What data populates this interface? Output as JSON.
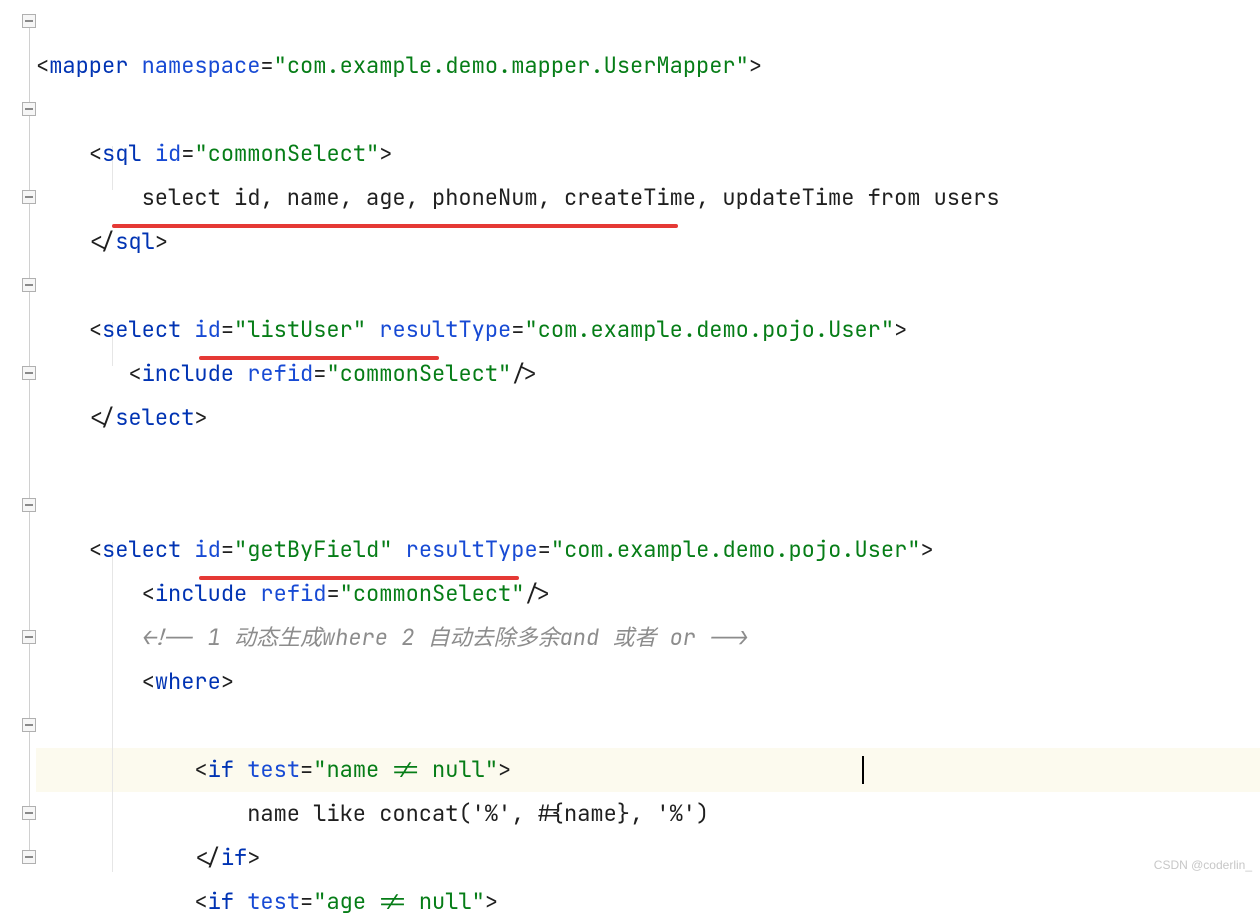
{
  "watermark": "CSDN @coderlin_",
  "tokens": {
    "lt": "<",
    "gt": ">",
    "lts": "</",
    "slgt": "/>",
    "eq": "=",
    "q": "\""
  },
  "tags": {
    "mapper": "mapper",
    "sql": "sql",
    "select": "select",
    "include": "include",
    "where": "where",
    "if": "if"
  },
  "attrs": {
    "namespace": "namespace",
    "id": "id",
    "resultType": "resultType",
    "refid": "refid",
    "test": "test"
  },
  "vals": {
    "ns": "com.example.demo.mapper.UserMapper",
    "commonSelect": "commonSelect",
    "listUser": "listUser",
    "userType": "com.example.demo.pojo.User",
    "getByField": "getByField",
    "testName": "name != null",
    "testAge": "age != null"
  },
  "text": {
    "selectLine": "select id, name, age, phoneNum, createTime, updateTime from users",
    "comment": "<!-- 1 动态生成where 2 自动去除多余and 或者 or -->",
    "nameLike": "name like concat('%', #{name}, '%')"
  }
}
